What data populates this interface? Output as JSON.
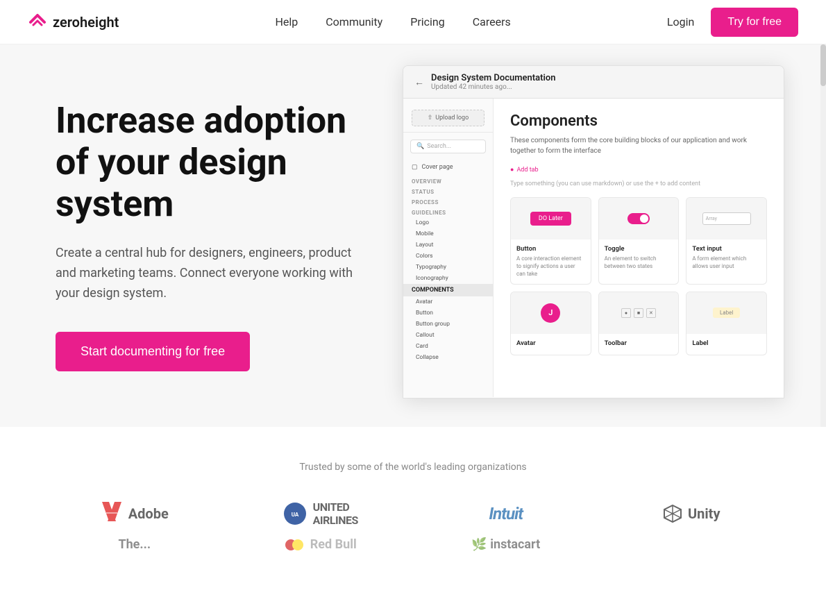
{
  "navbar": {
    "logo_text": "zeroheight",
    "links": [
      {
        "label": "Help",
        "id": "help"
      },
      {
        "label": "Community",
        "id": "community"
      },
      {
        "label": "Pricing",
        "id": "pricing"
      },
      {
        "label": "Careers",
        "id": "careers"
      }
    ],
    "login_label": "Login",
    "try_label": "Try for free"
  },
  "hero": {
    "title": "Increase adoption of your design system",
    "subtitle": "Create a central hub for designers, engineers, product and marketing teams. Connect everyone working with your design system.",
    "cta_label": "Start documenting for free"
  },
  "mockup": {
    "doc_title": "Design System Documentation",
    "doc_sub": "Updated 42 minutes ago...",
    "upload_label": "Upload logo",
    "search_placeholder": "Search...",
    "cover_page_label": "Cover page",
    "sections": [
      {
        "label": "OVERVIEW",
        "items": []
      },
      {
        "label": "STATUS",
        "items": []
      },
      {
        "label": "PROCESS",
        "items": []
      },
      {
        "label": "GUIDELINES",
        "items": [
          "Logo",
          "Mobile",
          "Layout",
          "Colors",
          "Typography",
          "Iconography"
        ]
      },
      {
        "label": "COMPONENTS",
        "items": [
          "Avatar",
          "Button",
          "Button group",
          "Callout",
          "Card",
          "Collapse"
        ],
        "active": true
      }
    ],
    "main_title": "Components",
    "main_desc": "These components form the core building blocks of our application and work together to form the interface",
    "add_tab_label": "Add tab",
    "type_hint": "Type something (you can use markdown) or use the + to add content",
    "components": [
      {
        "name": "Button",
        "desc": "A core interaction element to signify actions a user can take",
        "preview_type": "button"
      },
      {
        "name": "Toggle",
        "desc": "An element to switch between two states",
        "preview_type": "toggle"
      },
      {
        "name": "Text input",
        "desc": "A form element which allows user input",
        "preview_type": "text-input"
      },
      {
        "name": "Avatar",
        "desc": "",
        "preview_type": "avatar"
      },
      {
        "name": "Toolbar",
        "desc": "",
        "preview_type": "toolbar"
      },
      {
        "name": "Label",
        "desc": "",
        "preview_type": "label"
      }
    ]
  },
  "trusted": {
    "text": "Trusted by some of the world's leading organizations",
    "logos": [
      {
        "name": "Adobe",
        "id": "adobe"
      },
      {
        "name": "United Airlines",
        "id": "united-airlines"
      },
      {
        "name": "Intuit",
        "id": "intuit"
      },
      {
        "name": "Unity",
        "id": "unity"
      }
    ],
    "partial_logos": [
      {
        "name": "The...",
        "id": "the"
      },
      {
        "name": "Red Bull",
        "id": "redbull"
      },
      {
        "name": "Instacart",
        "id": "instacart"
      }
    ]
  }
}
